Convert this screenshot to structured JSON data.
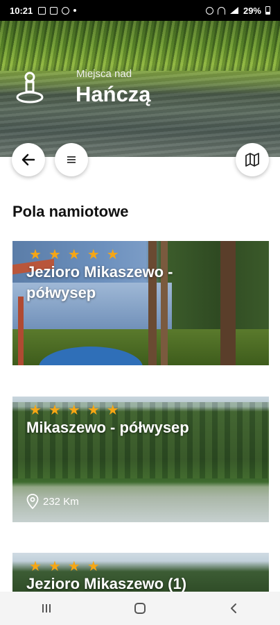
{
  "status_bar": {
    "time": "10:21",
    "battery": "29%",
    "left_icons": [
      "image-icon",
      "message-icon",
      "settings-icon",
      "dot-icon"
    ],
    "right_icons": [
      "alarm-icon",
      "wifi-icon",
      "signal-icon"
    ]
  },
  "header": {
    "subtitle": "Miejsca nad",
    "title": "Hańczą"
  },
  "controls": {
    "back_icon": "arrow-left-icon",
    "menu_icon": "menu-icon",
    "map_icon": "map-icon"
  },
  "section": {
    "title": "Pola namiotowe"
  },
  "cards": [
    {
      "title": "Jezioro Mikaszewo - półwysep",
      "stars": 5,
      "distance": ""
    },
    {
      "title": "Mikaszewo - półwysep",
      "stars": 5,
      "distance": "232 Km"
    },
    {
      "title": "Jezioro Mikaszewo (1)",
      "stars": 4,
      "distance": ""
    }
  ],
  "colors": {
    "star": "#f6a615",
    "background": "#ffffff",
    "accent_text": "#111111"
  },
  "nav": {
    "items": [
      "recent-apps-icon",
      "home-icon",
      "back-icon"
    ]
  }
}
